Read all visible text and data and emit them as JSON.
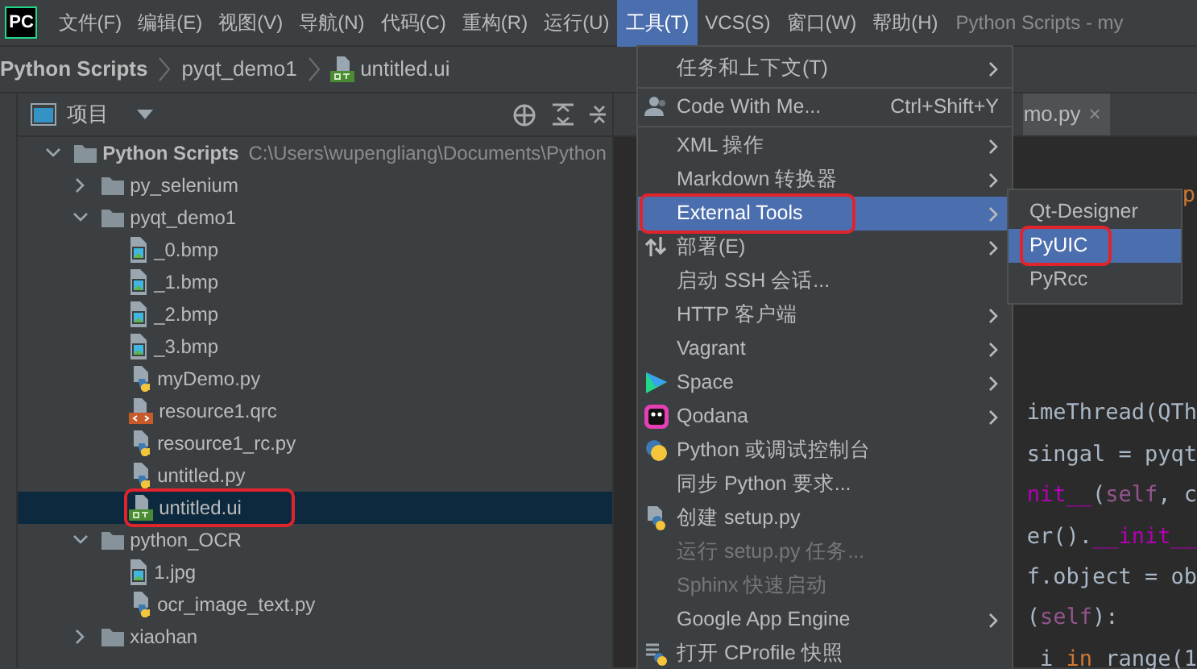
{
  "app_logo": "PC",
  "menubar": [
    {
      "label": "文件(F)",
      "selected": false
    },
    {
      "label": "编辑(E)",
      "selected": false
    },
    {
      "label": "视图(V)",
      "selected": false
    },
    {
      "label": "导航(N)",
      "selected": false
    },
    {
      "label": "代码(C)",
      "selected": false
    },
    {
      "label": "重构(R)",
      "selected": false
    },
    {
      "label": "运行(U)",
      "selected": false
    },
    {
      "label": "工具(T)",
      "selected": true
    },
    {
      "label": "VCS(S)",
      "selected": false
    },
    {
      "label": "窗口(W)",
      "selected": false
    },
    {
      "label": "帮助(H)",
      "selected": false
    }
  ],
  "window_title": "Python Scripts - my",
  "breadcrumbs": [
    {
      "label": "Python Scripts",
      "kind": "text"
    },
    {
      "label": "pyqt_demo1",
      "kind": "text"
    },
    {
      "label": "untitled.ui",
      "kind": "qt"
    }
  ],
  "project_panel": {
    "title": "项目",
    "tree": [
      {
        "label": "Python Scripts",
        "path": "C:\\Users\\wupengliang\\Documents\\Python",
        "kind": "folder",
        "expanded": true,
        "selected": false,
        "annotated": false,
        "children": [
          {
            "label": "py_selenium",
            "kind": "folder",
            "expanded": false,
            "selected": false,
            "annotated": false
          },
          {
            "label": "pyqt_demo1",
            "kind": "folder",
            "expanded": true,
            "selected": false,
            "annotated": false,
            "children": [
              {
                "label": "_0.bmp",
                "kind": "image",
                "selected": false,
                "annotated": false
              },
              {
                "label": "_1.bmp",
                "kind": "image",
                "selected": false,
                "annotated": false
              },
              {
                "label": "_2.bmp",
                "kind": "image",
                "selected": false,
                "annotated": false
              },
              {
                "label": "_3.bmp",
                "kind": "image",
                "selected": false,
                "annotated": false
              },
              {
                "label": "myDemo.py",
                "kind": "python",
                "selected": false,
                "annotated": false
              },
              {
                "label": "resource1.qrc",
                "kind": "qrc",
                "selected": false,
                "annotated": false
              },
              {
                "label": "resource1_rc.py",
                "kind": "python",
                "selected": false,
                "annotated": false
              },
              {
                "label": "untitled.py",
                "kind": "python",
                "selected": false,
                "annotated": false
              },
              {
                "label": "untitled.ui",
                "kind": "qt",
                "selected": true,
                "annotated": true
              }
            ]
          },
          {
            "label": "python_OCR",
            "kind": "folder",
            "expanded": true,
            "selected": false,
            "annotated": false,
            "children": [
              {
                "label": "1.jpg",
                "kind": "image",
                "selected": false,
                "annotated": false
              },
              {
                "label": "ocr_image_text.py",
                "kind": "python",
                "selected": false,
                "annotated": false
              }
            ]
          },
          {
            "label": "xiaohan",
            "kind": "folder",
            "expanded": false,
            "selected": false,
            "annotated": false
          }
        ]
      }
    ]
  },
  "editor": {
    "tab": {
      "label": "mo.py",
      "close": "×"
    },
    "code_lines": [
      [
        {
          "t": "p",
          "kind": "keyword"
        }
      ],
      [
        {
          "t": "imeThread(QTh",
          "kind": "plain"
        }
      ],
      [
        {
          "t": "singal",
          "kind": "plain"
        },
        {
          "t": " = pyqt",
          "kind": "plain"
        }
      ],
      [
        {
          "t": "nit__",
          "kind": "magic"
        },
        {
          "t": "(",
          "kind": "plain"
        },
        {
          "t": "self",
          "kind": "self"
        },
        {
          "t": ", c",
          "kind": "plain"
        }
      ],
      [
        {
          "t": "er().",
          "kind": "plain"
        },
        {
          "t": "__init__",
          "kind": "magic"
        }
      ],
      [
        {
          "t": "f.object = ob",
          "kind": "plain"
        }
      ],
      [
        {
          "t": "(",
          "kind": "plain"
        },
        {
          "t": "self",
          "kind": "self"
        },
        {
          "t": "):",
          "kind": "plain"
        }
      ],
      [
        {
          "t": " i ",
          "kind": "plain"
        },
        {
          "t": "in",
          "kind": "keyword"
        },
        {
          "t": " range(1",
          "kind": "plain"
        }
      ]
    ]
  },
  "tools_menu": [
    {
      "kind": "plain",
      "label": "任务和上下文(T)",
      "submenu": true,
      "disabled": false,
      "selected": false,
      "annotated": false
    },
    {
      "kind": "separator"
    },
    {
      "kind": "people",
      "label": "Code With Me...",
      "shortcut": "Ctrl+Shift+Y",
      "submenu": false,
      "disabled": false,
      "selected": false,
      "annotated": false
    },
    {
      "kind": "separator"
    },
    {
      "kind": "plain",
      "label": "XML 操作",
      "submenu": true,
      "disabled": false,
      "selected": false,
      "annotated": false
    },
    {
      "kind": "plain",
      "label": "Markdown 转换器",
      "submenu": true,
      "disabled": false,
      "selected": false,
      "annotated": false
    },
    {
      "kind": "plain",
      "label": "External Tools",
      "submenu": true,
      "disabled": false,
      "selected": true,
      "annotated": true
    },
    {
      "kind": "arrows",
      "label": "部署(E)",
      "submenu": true,
      "disabled": false,
      "selected": false,
      "annotated": false
    },
    {
      "kind": "plain",
      "label": "启动 SSH 会话...",
      "submenu": false,
      "disabled": false,
      "selected": false,
      "annotated": false
    },
    {
      "kind": "plain",
      "label": "HTTP 客户端",
      "submenu": true,
      "disabled": false,
      "selected": false,
      "annotated": false
    },
    {
      "kind": "plain",
      "label": "Vagrant",
      "submenu": true,
      "disabled": false,
      "selected": false,
      "annotated": false
    },
    {
      "kind": "space",
      "label": "Space",
      "submenu": true,
      "disabled": false,
      "selected": false,
      "annotated": false
    },
    {
      "kind": "qodana",
      "label": "Qodana",
      "submenu": true,
      "disabled": false,
      "selected": false,
      "annotated": false
    },
    {
      "kind": "python-console",
      "label": "Python 或调试控制台",
      "submenu": false,
      "disabled": false,
      "selected": false,
      "annotated": false
    },
    {
      "kind": "plain",
      "label": "同步 Python 要求...",
      "submenu": false,
      "disabled": false,
      "selected": false,
      "annotated": false
    },
    {
      "kind": "python-file",
      "label": "创建 setup.py",
      "submenu": false,
      "disabled": false,
      "selected": false,
      "annotated": false
    },
    {
      "kind": "plain",
      "label": "运行 setup.py 任务...",
      "submenu": false,
      "disabled": true,
      "selected": false,
      "annotated": false
    },
    {
      "kind": "plain",
      "label": "Sphinx 快速启动",
      "submenu": false,
      "disabled": true,
      "selected": false,
      "annotated": false
    },
    {
      "kind": "plain",
      "label": "Google App Engine",
      "submenu": true,
      "disabled": false,
      "selected": false,
      "annotated": false
    },
    {
      "kind": "profile",
      "label": "打开 CProfile 快照",
      "submenu": false,
      "disabled": false,
      "selected": false,
      "annotated": false
    }
  ],
  "external_tools_submenu": [
    {
      "label": "Qt-Designer",
      "selected": false,
      "annotated": false
    },
    {
      "label": "PyUIC",
      "selected": true,
      "annotated": true
    },
    {
      "label": "PyRcc",
      "selected": false,
      "annotated": false
    }
  ]
}
